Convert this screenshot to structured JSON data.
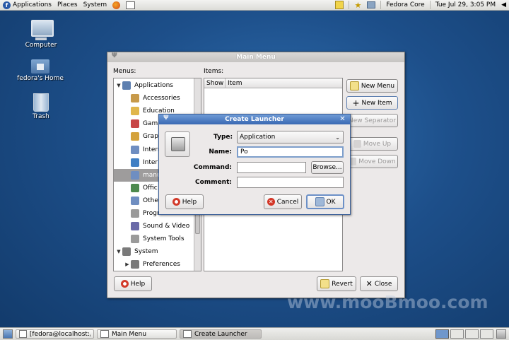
{
  "top_panel": {
    "menus": [
      "Applications",
      "Places",
      "System"
    ],
    "user": "Fedora Core",
    "clock": "Tue Jul 29,  3:05 PM"
  },
  "desktop": {
    "icons": [
      {
        "label": "Computer",
        "icon": "computer-icon"
      },
      {
        "label": "fedora's Home",
        "icon": "home-folder-icon"
      },
      {
        "label": "Trash",
        "icon": "trash-icon"
      }
    ]
  },
  "main_menu": {
    "title": "Main Menu",
    "menus_label": "Menus:",
    "items_label": "Items:",
    "columns": [
      "Show",
      "Item"
    ],
    "tree": [
      {
        "label": "Applications",
        "level": 0,
        "expander": "▼"
      },
      {
        "label": "Accessories",
        "level": 1
      },
      {
        "label": "Education",
        "level": 1
      },
      {
        "label": "Gam",
        "level": 1
      },
      {
        "label": "Grap",
        "level": 1
      },
      {
        "label": "Intern",
        "level": 1
      },
      {
        "label": "Inter",
        "level": 1
      },
      {
        "label": "manu",
        "level": 1,
        "selected": true
      },
      {
        "label": "Offic",
        "level": 1
      },
      {
        "label": "Other",
        "level": 1
      },
      {
        "label": "Progr",
        "level": 1
      },
      {
        "label": "Sound & Video",
        "level": 1
      },
      {
        "label": "System Tools",
        "level": 1
      },
      {
        "label": "System",
        "level": 0,
        "expander": "▼"
      },
      {
        "label": "Preferences",
        "level": 1,
        "expander": "▶"
      }
    ],
    "buttons": {
      "new_menu": "New Menu",
      "new_item": "New Item",
      "new_separator": "New Separator",
      "move_up": "Move Up",
      "move_down": "Move Down",
      "help": "Help",
      "revert": "Revert",
      "close": "Close"
    }
  },
  "create_launcher": {
    "title": "Create Launcher",
    "type_label": "Type:",
    "type_value": "Application",
    "name_label": "Name:",
    "name_value": "Po",
    "command_label": "Command:",
    "command_value": "",
    "browse": "Browse...",
    "comment_label": "Comment:",
    "comment_value": "",
    "help": "Help",
    "cancel": "Cancel",
    "ok": "OK"
  },
  "taskbar": {
    "tasks": [
      "[fedora@localhost:/...",
      "Main Menu",
      "Create Launcher"
    ]
  },
  "watermark": "www.mooBmoo.com",
  "colors": {
    "desktop": "#1d4f8a",
    "active_title": "#3968b3",
    "selected_row": "#9e9c9c"
  }
}
